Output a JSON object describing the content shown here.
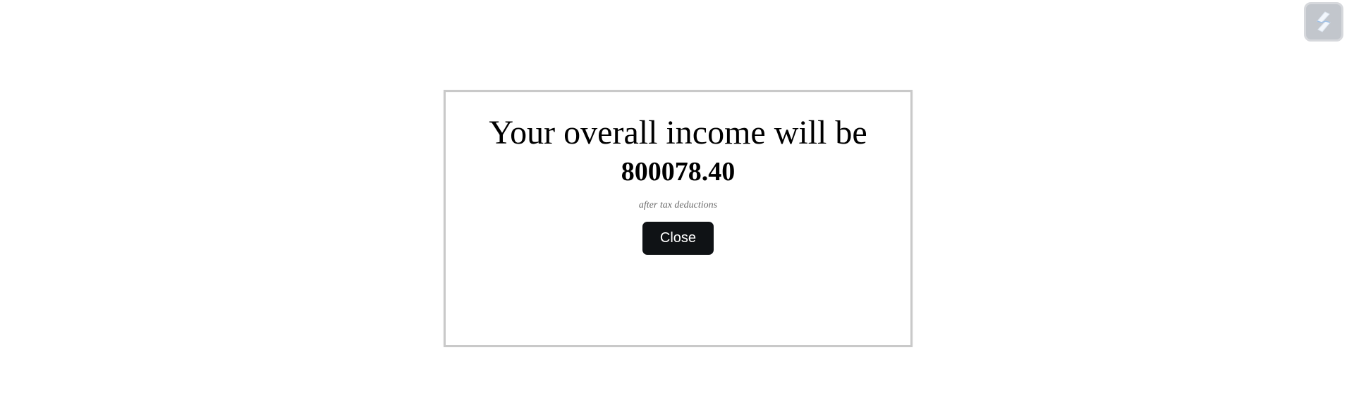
{
  "modal": {
    "title": "Your overall income will be",
    "amount": "800078.40",
    "note": "after tax deductions",
    "close_label": "Close"
  },
  "corner_badge": {
    "icon": "app-logo-icon"
  },
  "colors": {
    "button_bg": "#0f1215",
    "button_text": "#ffffff",
    "modal_border": "#c9c9c9",
    "note_text": "#6b6b6b",
    "badge_bg": "#c2c6cc"
  }
}
